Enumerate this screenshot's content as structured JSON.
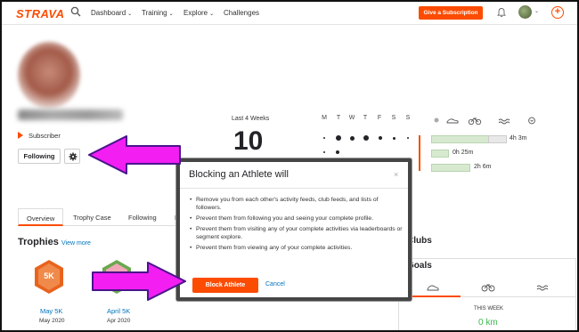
{
  "header": {
    "logo": "STRAVA",
    "nav": [
      {
        "label": "Dashboard",
        "chev": "⌄"
      },
      {
        "label": "Training",
        "chev": "⌄"
      },
      {
        "label": "Explore",
        "chev": "⌄"
      },
      {
        "label": "Challenges",
        "chev": ""
      }
    ],
    "subscribe_label": "Give a Subscription",
    "plus_label": "+",
    "avatar_chev": "⌄"
  },
  "profile": {
    "badge": "Subscriber",
    "following_label": "Following"
  },
  "stats": {
    "label": "Last 4 Weeks",
    "value": "10",
    "days": [
      "M",
      "T",
      "W",
      "T",
      "F",
      "S",
      "S"
    ],
    "rows": [
      {
        "value": "4h 3m"
      },
      {
        "value": "0h 25m"
      },
      {
        "value": "2h 6m"
      }
    ]
  },
  "tabs": [
    "Overview",
    "Trophy Case",
    "Following",
    "F"
  ],
  "trophies": {
    "title": "Trophies",
    "view_more": "View more",
    "items": [
      {
        "badge": "5K",
        "title": "May 5K",
        "date": "May 2020",
        "color": "#e8631e"
      },
      {
        "badge": "5K",
        "title": "April 5K",
        "date": "Apr 2020",
        "color": "#6aa84f"
      }
    ]
  },
  "right": {
    "clubs": "Clubs",
    "goals": "Goals",
    "this_week": "THIS WEEK",
    "km": "0 km"
  },
  "modal": {
    "title": "Blocking an Athlete will",
    "close": "×",
    "items": [
      "Remove you from each other's activity feeds, club feeds, and lists of followers.",
      "Prevent them from following you and seeing your complete profile.",
      "Prevent them from visiting any of your complete activities via leaderboards or segment explore.",
      "Prevent them from viewing any of your complete activities."
    ],
    "block_label": "Block Athlete",
    "cancel_label": "Cancel"
  },
  "colors": {
    "accent": "#fc4c02",
    "link": "#0073bb",
    "annotation_arrow": "#f21ef2"
  }
}
